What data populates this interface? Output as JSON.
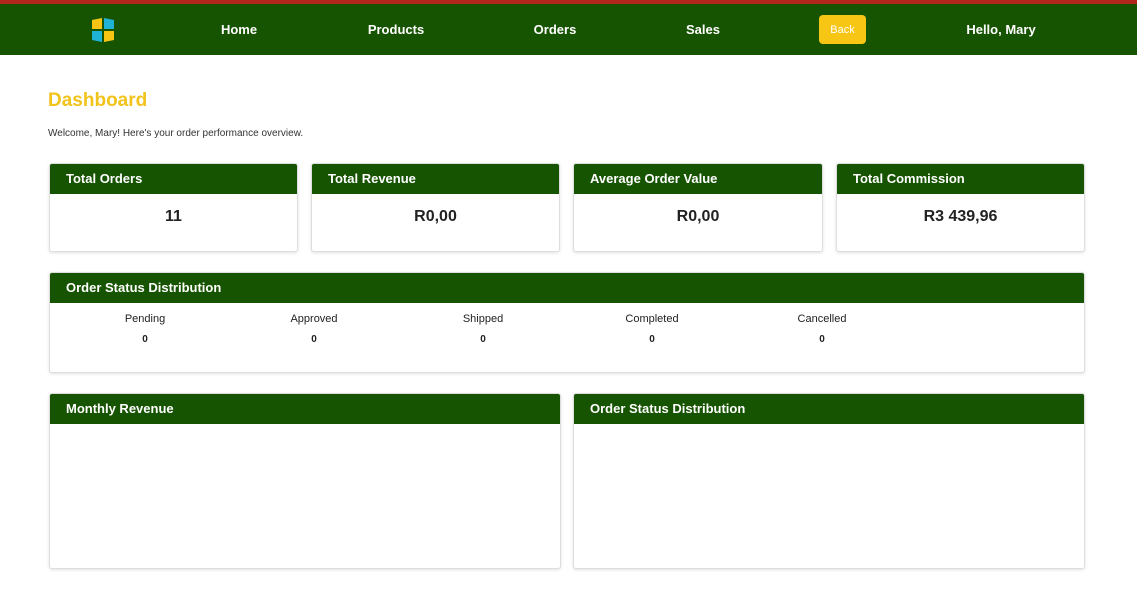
{
  "nav": {
    "links": [
      "Home",
      "Products",
      "Orders",
      "Sales"
    ],
    "back_label": "Back",
    "greeting": "Hello, Mary"
  },
  "page": {
    "title": "Dashboard",
    "welcome": "Welcome, Mary! Here's your order performance overview."
  },
  "stats": [
    {
      "label": "Total Orders",
      "value": "11"
    },
    {
      "label": "Total Revenue",
      "value": "R0,00"
    },
    {
      "label": "Average Order Value",
      "value": "R0,00"
    },
    {
      "label": "Total Commission",
      "value": "R3 439,96"
    }
  ],
  "status_distribution": {
    "title": "Order Status Distribution",
    "items": [
      {
        "label": "Pending",
        "count": "0"
      },
      {
        "label": "Approved",
        "count": "0"
      },
      {
        "label": "Shipped",
        "count": "0"
      },
      {
        "label": "Completed",
        "count": "0"
      },
      {
        "label": "Cancelled",
        "count": "0"
      }
    ]
  },
  "charts": {
    "monthly_revenue_title": "Monthly Revenue",
    "status_chart_title": "Order Status Distribution"
  },
  "colors": {
    "nav_bg": "#175402",
    "accent_yellow": "#f7c615",
    "title_yellow": "#f2c31a",
    "top_line": "#b3261e"
  },
  "icons": {
    "logo": "brand-logo-icon"
  }
}
